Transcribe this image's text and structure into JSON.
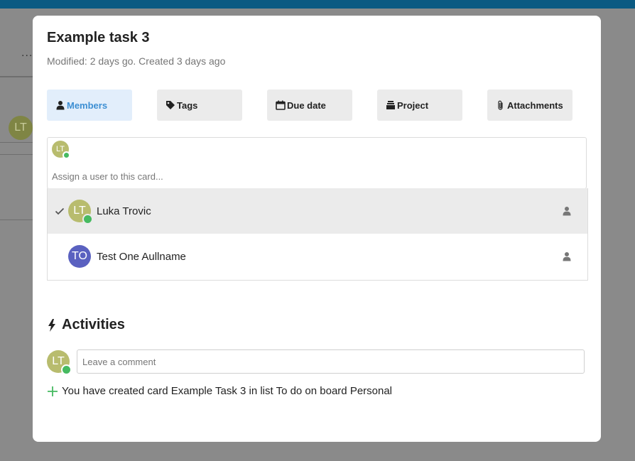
{
  "card": {
    "title": "Example task 3",
    "meta": "Modified: 2 days go. Created 3 days ago"
  },
  "tabs": [
    {
      "label": "Members",
      "icon": "person-icon",
      "active": true
    },
    {
      "label": "Tags",
      "icon": "tag-icon",
      "active": false
    },
    {
      "label": "Due date",
      "icon": "calendar-icon",
      "active": false
    },
    {
      "label": "Project",
      "icon": "stack-icon",
      "active": false
    },
    {
      "label": "Attachments",
      "icon": "paperclip-icon",
      "active": false
    }
  ],
  "assign": {
    "selected_initials": "LT",
    "placeholder": "Assign a user to this card..."
  },
  "users": [
    {
      "initials": "LT",
      "name": "Luka Trovic",
      "selected": true,
      "online": true,
      "color": "#b8bc6e"
    },
    {
      "initials": "TO",
      "name": "Test One Aullname",
      "selected": false,
      "online": false,
      "color": "#5a61c0"
    }
  ],
  "activities": {
    "title": "Activities",
    "comment_initials": "LT",
    "comment_placeholder": "Leave a comment",
    "items": [
      {
        "text": "You have created card Example Task 3 in list To do on board Personal"
      }
    ]
  },
  "background": {
    "dots": "...",
    "avatar_initials": "LT"
  },
  "colors": {
    "accent": "#3d8fd3",
    "online": "#46ba61",
    "topbar": "#0b5a82"
  }
}
